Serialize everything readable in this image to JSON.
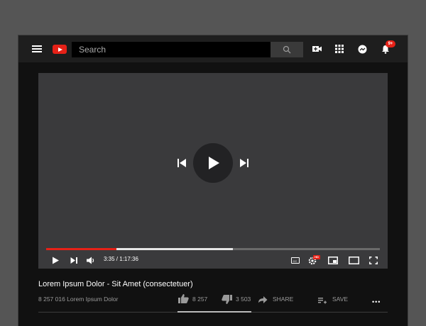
{
  "header": {
    "search": {
      "placeholder": "Search",
      "value": ""
    },
    "notifications_badge": "9+"
  },
  "player": {
    "progress_played_pct": 21,
    "progress_buffered_pct": 56,
    "current_time": "3:35",
    "separator": " / ",
    "duration": "1:17:36",
    "cc_text": "CC",
    "hd_badge": "HD"
  },
  "video": {
    "title": "Lorem Ipsum Dolor - Sit Amet (consectetuer)",
    "meta": "8 257 016 Lorem Ipsum Dolor",
    "likes": "8 257",
    "dislikes": "3 503",
    "share_label": "SHARE",
    "save_label": "SAVE",
    "more": "•••"
  },
  "colors": {
    "accent": "#e62117",
    "page_bg": "#555555",
    "app_bg": "#111111",
    "topbar_bg": "#1e1e1e",
    "player_bg": "#3a3a3c"
  }
}
